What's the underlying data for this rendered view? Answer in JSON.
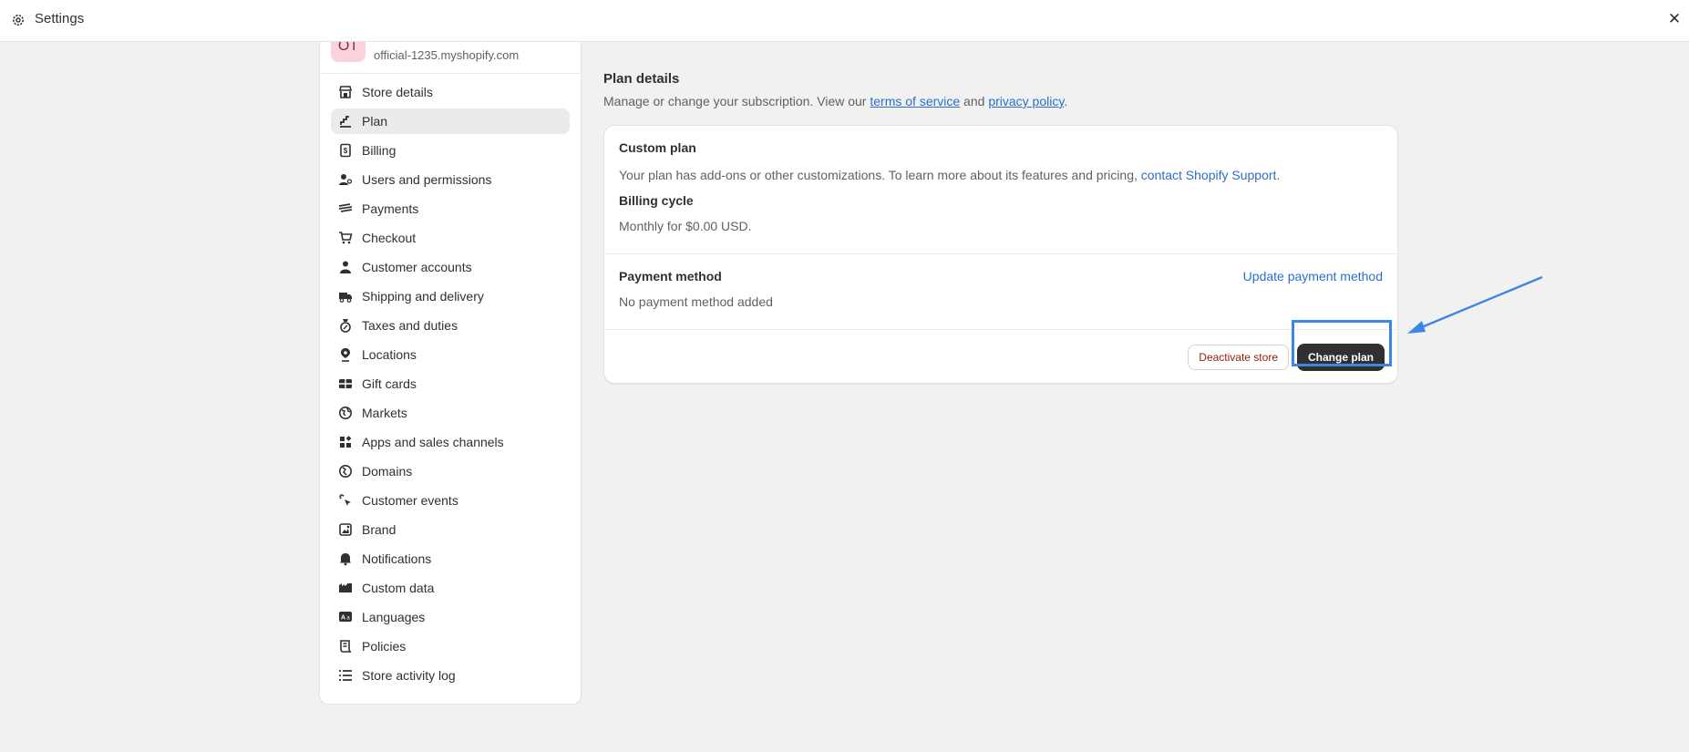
{
  "window": {
    "title": "Settings",
    "close_icon": "close-icon",
    "gear_icon": "gear-icon"
  },
  "store": {
    "avatar_initials": "OT",
    "url": "official-1235.myshopify.com"
  },
  "sidebar": {
    "items": [
      {
        "label": "Store details",
        "icon": "store-icon"
      },
      {
        "label": "Plan",
        "icon": "plan-icon",
        "active": true
      },
      {
        "label": "Billing",
        "icon": "billing-icon"
      },
      {
        "label": "Users and permissions",
        "icon": "users-icon"
      },
      {
        "label": "Payments",
        "icon": "payments-icon"
      },
      {
        "label": "Checkout",
        "icon": "cart-icon"
      },
      {
        "label": "Customer accounts",
        "icon": "person-icon"
      },
      {
        "label": "Shipping and delivery",
        "icon": "truck-icon"
      },
      {
        "label": "Taxes and duties",
        "icon": "taxes-icon"
      },
      {
        "label": "Locations",
        "icon": "location-icon"
      },
      {
        "label": "Gift cards",
        "icon": "gift-card-icon"
      },
      {
        "label": "Markets",
        "icon": "globe-icon"
      },
      {
        "label": "Apps and sales channels",
        "icon": "apps-icon"
      },
      {
        "label": "Domains",
        "icon": "domains-icon"
      },
      {
        "label": "Customer events",
        "icon": "cursor-icon"
      },
      {
        "label": "Brand",
        "icon": "brand-icon"
      },
      {
        "label": "Notifications",
        "icon": "bell-icon"
      },
      {
        "label": "Custom data",
        "icon": "custom-data-icon"
      },
      {
        "label": "Languages",
        "icon": "languages-icon"
      },
      {
        "label": "Policies",
        "icon": "policies-icon"
      },
      {
        "label": "Store activity log",
        "icon": "list-icon"
      }
    ]
  },
  "plan": {
    "title": "Plan details",
    "desc_prefix": "Manage or change your subscription. View our ",
    "tos_link": "terms of service",
    "desc_and": " and ",
    "privacy_link": "privacy policy",
    "desc_suffix": ".",
    "custom_plan_title": "Custom plan",
    "custom_plan_text": "Your plan has add-ons or other customizations. To learn more about its features and pricing, ",
    "support_link": "contact Shopify Support",
    "support_suffix": ".",
    "billing_cycle_title": "Billing cycle",
    "billing_cycle_value": "Monthly for $0.00 USD.",
    "payment_method_title": "Payment method",
    "update_payment_link": "Update payment method",
    "payment_method_value": "No payment method added",
    "deactivate_label": "Deactivate store",
    "change_plan_label": "Change plan"
  },
  "colors": {
    "accent": "#3b87e5",
    "link": "#2c6ecb",
    "primary_button": "#303030",
    "danger_text": "#8e1f0b"
  }
}
